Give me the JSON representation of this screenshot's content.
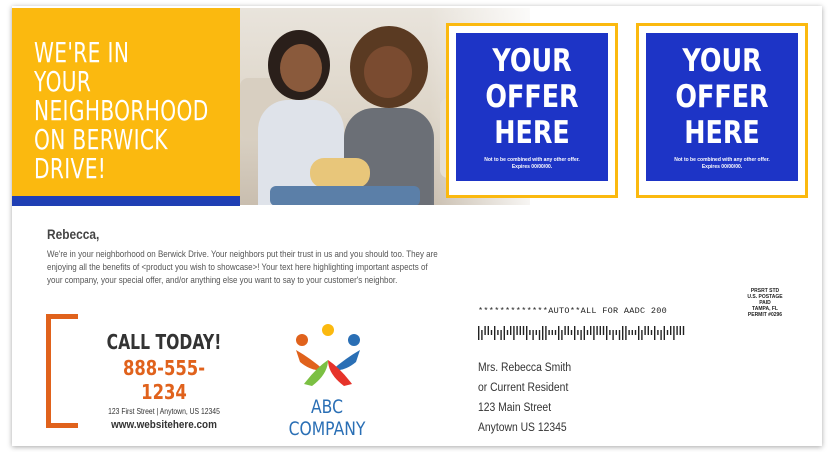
{
  "hero": {
    "title": "WE'RE IN YOUR\nNEIGHBORHOOD\nON BERWICK\nDRIVE!"
  },
  "offers": [
    {
      "title": "YOUR\nOFFER\nHERE",
      "fine_print": "Not to be combined with any other offer.\nExpires 00/00/00."
    },
    {
      "title": "YOUR\nOFFER\nHERE",
      "fine_print": "Not to be combined with any other offer.\nExpires 00/00/00."
    }
  ],
  "letter": {
    "greeting": "Rebecca,",
    "body": "We're in your neighborhood on Berwick Drive. Your neighbors put their trust in us and you should too. They are enjoying all the benefits of <product you wish to showcase>! Your text here highlighting important aspects of your company, your special offer, and/or anything else you want to say to your customer's neighbor."
  },
  "contact": {
    "cta": "CALL TODAY!",
    "phone": "888-555-1234",
    "address": "123 First Street | Anytown, US 12345",
    "website": "www.websitehere.com"
  },
  "company": {
    "name": "ABC COMPANY",
    "logo_colors": [
      "#e0621c",
      "#2a6fb5",
      "#7bc043",
      "#e6332a",
      "#fbb90f"
    ]
  },
  "mailing": {
    "postage": "PRSRT STD\nU.S. POSTAGE\nPAID\nTAMPA, FL\nPERMIT #0296",
    "barcode_line": "*************AUTO**ALL FOR AADC 200",
    "recipient": [
      "Mrs. Rebecca Smith",
      "or Current Resident",
      "123 Main Street",
      "Anytown US 12345"
    ]
  },
  "colors": {
    "yellow": "#fbb90f",
    "blue": "#1d34c6",
    "orange": "#e0621c"
  }
}
